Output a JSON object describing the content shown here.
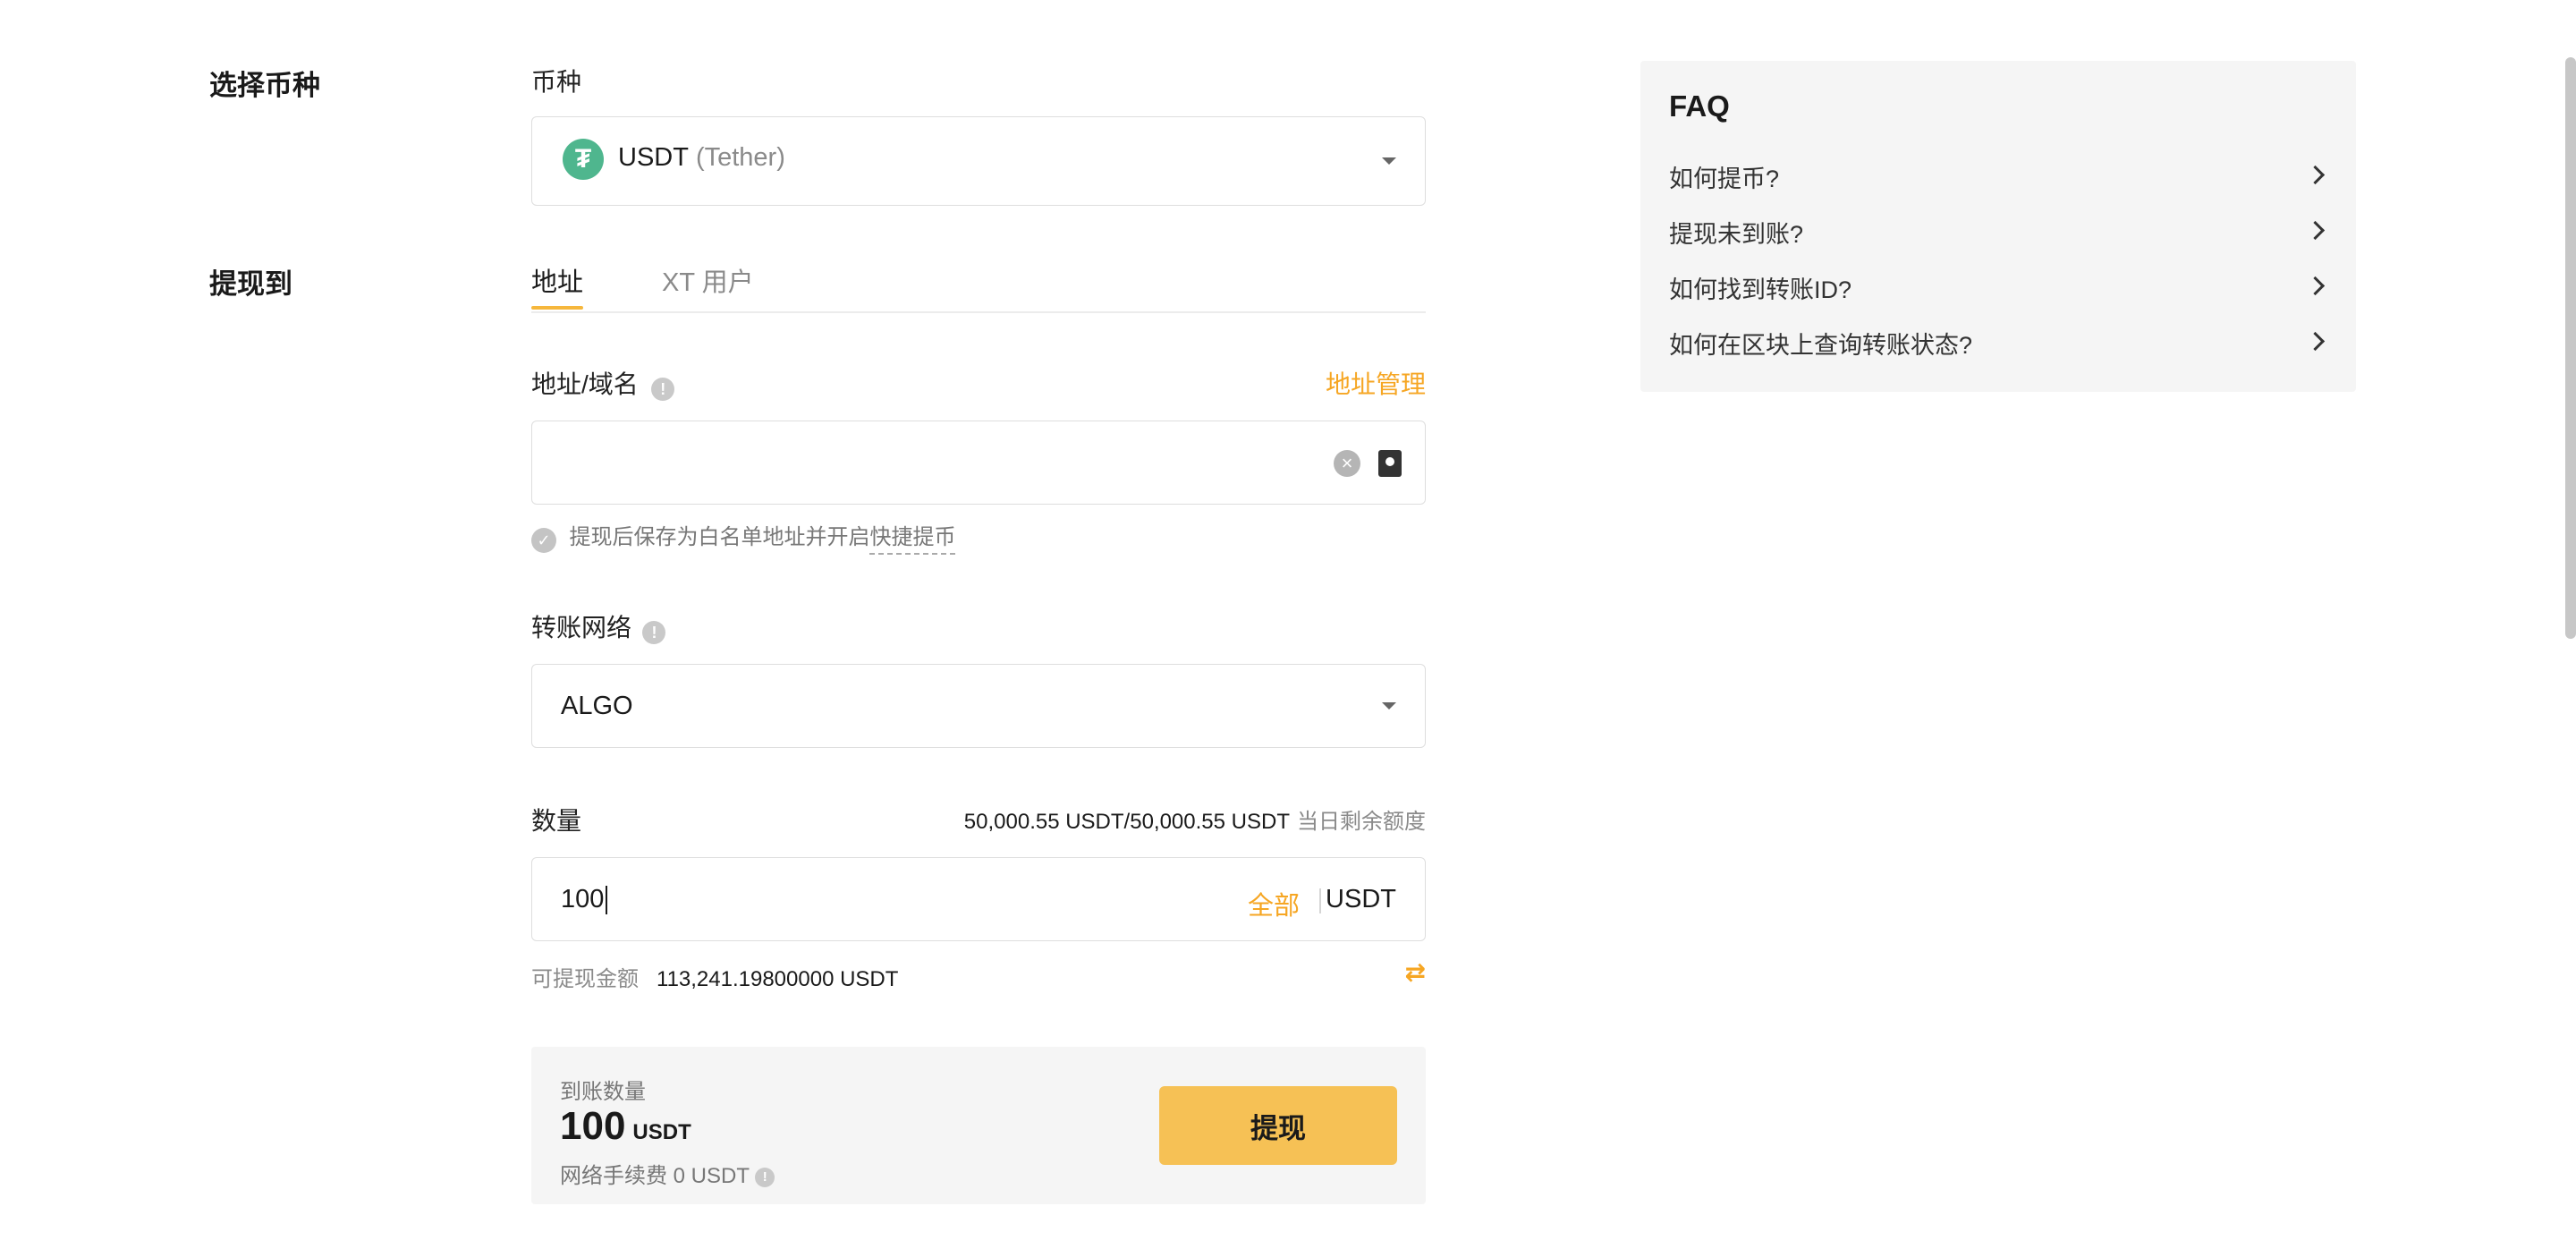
{
  "sections": {
    "select_coin": "选择币种",
    "withdraw_to": "提现到"
  },
  "coin": {
    "label": "币种",
    "symbol": "USDT",
    "name": "(Tether)",
    "logo_glyph": "₮",
    "logo_color": "#4fb68e"
  },
  "tabs": [
    {
      "label": "地址",
      "active": true
    },
    {
      "label": "XT 用户",
      "active": false
    }
  ],
  "address": {
    "label": "地址/域名",
    "manage_link": "地址管理",
    "value": "",
    "whitelist_hint": "提现后保存为白名单地址并开启",
    "quick_link": "快捷提币"
  },
  "network": {
    "label": "转账网络",
    "value": "ALGO"
  },
  "amount": {
    "label": "数量",
    "limit_value": "50,000.55 USDT/50,000.55 USDT",
    "limit_label": "当日剩余额度",
    "value": "100",
    "all_label": "全部",
    "unit": "USDT",
    "available_label": "可提现金额",
    "available_value": "113,241.19800000 USDT"
  },
  "summary": {
    "receive_label": "到账数量",
    "receive_amount": "100",
    "receive_unit": "USDT",
    "fee_text": "网络手续费 0 USDT",
    "withdraw_button": "提现"
  },
  "faq": {
    "title": "FAQ",
    "items": [
      "如何提币?",
      "提现未到账?",
      "如何找到转账ID?",
      "如何在区块上查询转账状态?"
    ]
  },
  "colors": {
    "accent": "#f6a623",
    "button": "#f6c155",
    "panel": "#f5f5f5"
  }
}
